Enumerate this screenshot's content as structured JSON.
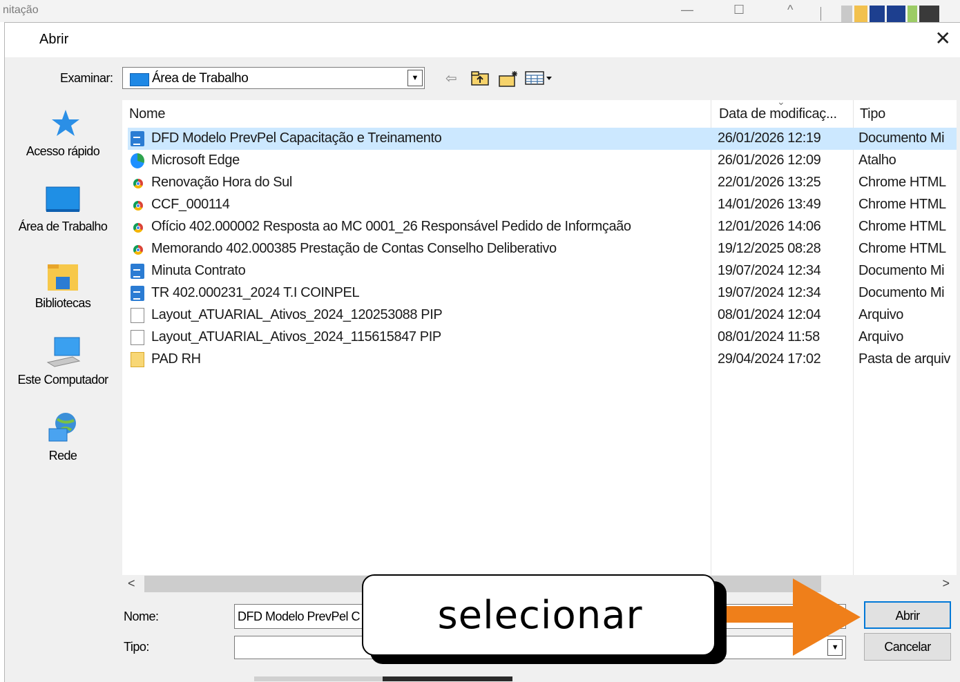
{
  "background_window": {
    "title_fragment": "nitação",
    "controls": [
      "—",
      "☐",
      "^"
    ]
  },
  "dialog": {
    "title": "Abrir",
    "close_glyph": "✕",
    "lookin_label": "Examinar:",
    "lookin_value": "Área de Trabalho",
    "toolbar_icons": [
      "back-arrow-icon",
      "up-folder-icon",
      "new-folder-icon",
      "view-menu-icon"
    ]
  },
  "places": [
    {
      "label": "Acesso rápido",
      "icon": "star-icon"
    },
    {
      "label": "Área de Trabalho",
      "icon": "desktop-icon"
    },
    {
      "label": "Bibliotecas",
      "icon": "libraries-icon"
    },
    {
      "label": "Este Computador",
      "icon": "computer-icon"
    },
    {
      "label": "Rede",
      "icon": "network-icon"
    }
  ],
  "columns": {
    "name": "Nome",
    "date": "Data de modificaç...",
    "type": "Tipo"
  },
  "files": [
    {
      "name": "DFD Modelo PrevPel Capacitação e Treinamento",
      "date": "26/01/2026 12:19",
      "type": "Documento Mi",
      "icon": "word",
      "selected": true
    },
    {
      "name": "Microsoft Edge",
      "date": "26/01/2026 12:09",
      "type": "Atalho",
      "icon": "edge"
    },
    {
      "name": "Renovação Hora do Sul",
      "date": "22/01/2026 13:25",
      "type": "Chrome HTML",
      "icon": "chrome"
    },
    {
      "name": "CCF_000114",
      "date": "14/01/2026 13:49",
      "type": "Chrome HTML",
      "icon": "chrome"
    },
    {
      "name": "Ofício 402.000002 Resposta ao MC 0001_26 Responsável Pedido de Informçaão",
      "date": "12/01/2026 14:06",
      "type": "Chrome HTML",
      "icon": "chrome"
    },
    {
      "name": "Memorando 402.000385 Prestação de Contas Conselho Deliberativo",
      "date": "19/12/2025 08:28",
      "type": "Chrome HTML",
      "icon": "chrome"
    },
    {
      "name": "Minuta Contrato",
      "date": "19/07/2024 12:34",
      "type": "Documento Mi",
      "icon": "word"
    },
    {
      "name": "TR 402.000231_2024 T.I COINPEL",
      "date": "19/07/2024 12:34",
      "type": "Documento Mi",
      "icon": "word"
    },
    {
      "name": "Layout_ATUARIAL_Ativos_2024_120253088 PIP",
      "date": "08/01/2024 12:04",
      "type": "Arquivo",
      "icon": "file"
    },
    {
      "name": "Layout_ATUARIAL_Ativos_2024_115615847 PIP",
      "date": "08/01/2024 11:58",
      "type": "Arquivo",
      "icon": "file"
    },
    {
      "name": "PAD RH",
      "date": "29/04/2024 17:02",
      "type": "Pasta de arquiv",
      "icon": "folder"
    }
  ],
  "scrollbar": {
    "left": "<",
    "right": ">"
  },
  "footer": {
    "name_label": "Nome:",
    "name_value": "DFD Modelo PrevPel C",
    "type_label": "Tipo:",
    "type_value": "",
    "open_button": "Abrir",
    "cancel_button": "Cancelar"
  },
  "annotation": {
    "text": "selecionar",
    "arrow_color": "#ef7f1a"
  },
  "colors": {
    "selection": "#cce8ff",
    "accent": "#0078d7"
  }
}
